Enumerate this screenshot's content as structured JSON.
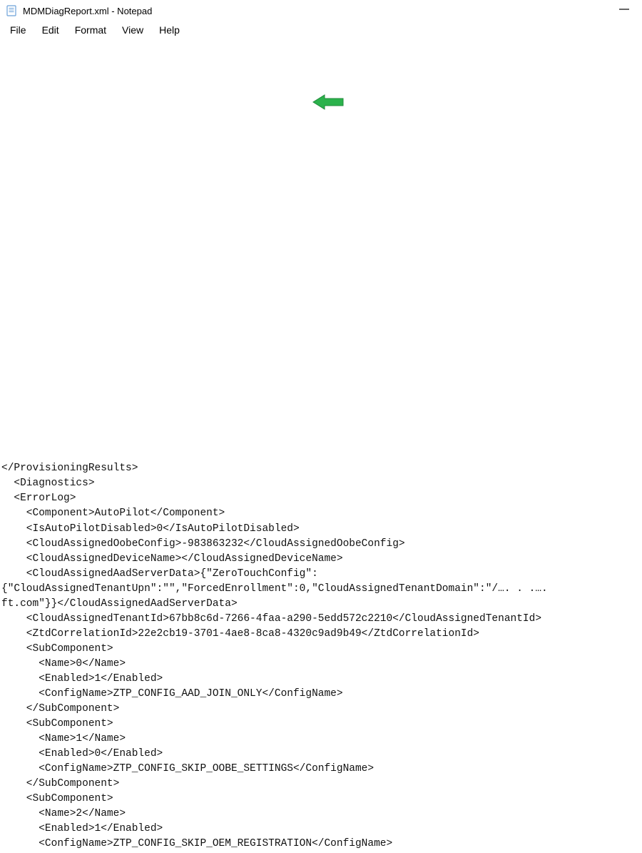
{
  "title": "MDMDiagReport.xml - Notepad",
  "menu": {
    "file": "File",
    "edit": "Edit",
    "format": "Format",
    "view": "View",
    "help": "Help"
  },
  "lines": [
    "</ProvisioningResults>",
    "  <Diagnostics>",
    "  <ErrorLog>",
    "    <Component>AutoPilot</Component>",
    "    <IsAutoPilotDisabled>0</IsAutoPilotDisabled>",
    "    <CloudAssignedOobeConfig>-983863232</CloudAssignedOobeConfig>",
    "    <CloudAssignedDeviceName></CloudAssignedDeviceName>",
    "    <CloudAssignedAadServerData>{\"ZeroTouchConfig\":",
    "{\"CloudAssignedTenantUpn\":\"\",\"ForcedEnrollment\":0,\"CloudAssignedTenantDomain\":\"/…. . .….",
    "ft.com\"}}</CloudAssignedAadServerData>",
    "    <CloudAssignedTenantId>67bb8c6d-7266-4faa-a290-5edd572c2210</CloudAssignedTenantId>",
    "    <ZtdCorrelationId>22e2cb19-3701-4ae8-8ca8-4320c9ad9b49</ZtdCorrelationId>",
    "    <SubComponent>",
    "      <Name>0</Name>",
    "      <Enabled>1</Enabled>",
    "      <ConfigName>ZTP_CONFIG_AAD_JOIN_ONLY</ConfigName>",
    "    </SubComponent>",
    "    <SubComponent>",
    "      <Name>1</Name>",
    "      <Enabled>0</Enabled>",
    "      <ConfigName>ZTP_CONFIG_SKIP_OOBE_SETTINGS</ConfigName>",
    "    </SubComponent>",
    "    <SubComponent>",
    "      <Name>2</Name>",
    "      <Enabled>1</Enabled>",
    "      <ConfigName>ZTP_CONFIG_SKIP_OEM_REGISTRATION</ConfigName>"
  ]
}
